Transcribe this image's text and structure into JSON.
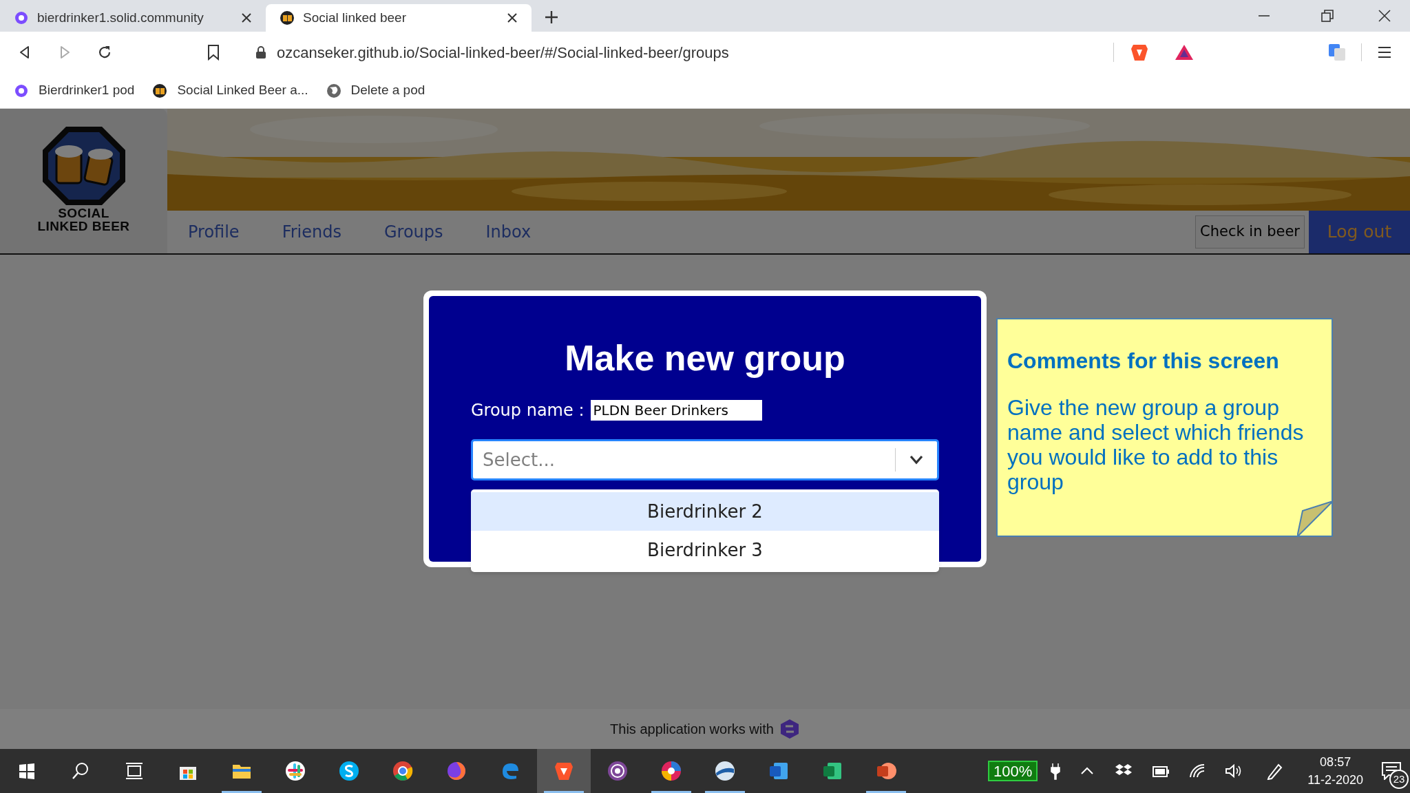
{
  "browser": {
    "tabs": [
      {
        "title": "bierdrinker1.solid.community",
        "selected": false
      },
      {
        "title": "Social linked beer",
        "selected": true
      }
    ],
    "address": "ozcanseker.github.io/Social-linked-beer/#/Social-linked-beer/groups",
    "bookmarks": [
      "Bierdrinker1 pod",
      "Social Linked Beer a...",
      "Delete a pod"
    ]
  },
  "app": {
    "logo_lines": [
      "SOCIAL",
      "LINKED BEER"
    ],
    "nav": [
      {
        "label": "Profile"
      },
      {
        "label": "Friends"
      },
      {
        "label": "Groups"
      },
      {
        "label": "Inbox"
      }
    ],
    "check_in_button": "Check in beer",
    "logout_button": "Log out",
    "footer_text": "This application works with"
  },
  "modal": {
    "title": "Make new group",
    "group_name_label": "Group name :",
    "group_name_value": "PLDN Beer Drinkers",
    "select": {
      "placeholder": "Select..."
    },
    "options": [
      {
        "label": "Bierdrinker 2",
        "selected": true
      },
      {
        "label": "Bierdrinker 3",
        "selected": false
      }
    ]
  },
  "note": {
    "title": "Comments for this screen",
    "body": "Give the new group a group name and select which friends you would like to add to this group"
  },
  "taskbar": {
    "apps": [
      {
        "running": false,
        "active": false
      },
      {
        "running": false,
        "active": false
      },
      {
        "running": false,
        "active": false
      },
      {
        "running": false,
        "active": false
      },
      {
        "running": true,
        "active": false
      },
      {
        "running": false,
        "active": false
      },
      {
        "running": false,
        "active": false
      },
      {
        "running": false,
        "active": false
      },
      {
        "running": false,
        "active": false
      },
      {
        "running": false,
        "active": false
      },
      {
        "running": true,
        "active": true
      },
      {
        "running": false,
        "active": false
      },
      {
        "running": true,
        "active": false
      },
      {
        "running": true,
        "active": false
      },
      {
        "running": false,
        "active": false
      },
      {
        "running": false,
        "active": false
      },
      {
        "running": true,
        "active": false
      }
    ],
    "battery": "100%",
    "time": "08:57",
    "date": "11-2-2020",
    "notifications": "23"
  }
}
